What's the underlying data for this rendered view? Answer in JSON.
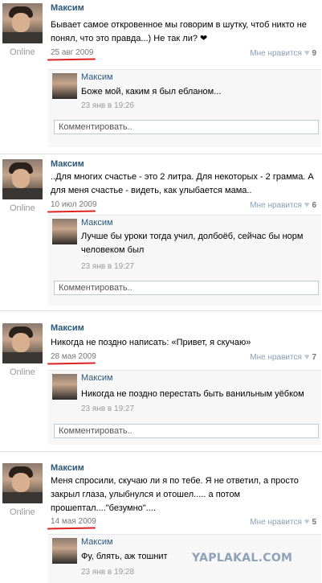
{
  "posts": [
    {
      "author": "Максим",
      "status": "Online",
      "text": "Бывает самое откровенное мы говорим в шутку, чтоб никто не понял, что это правда...) Не так ли? ❤",
      "date": "25 авг 2009",
      "like_label": "Мне нравится",
      "like_count": "9",
      "reply": {
        "author": "Максим",
        "text": "Боже мой, каким я был ебланом...",
        "date": "23 янв в 19:26"
      },
      "comment_placeholder": "Комментировать.."
    },
    {
      "author": "Максим",
      "status": "Online",
      "text": "..Для многих счастье - это 2 литра. Для некоторых - 2 грамма. А для меня счастье - видеть, как улыбается мама..",
      "date": "10 июл 2009",
      "like_label": "Мне нравится",
      "like_count": "6",
      "reply": {
        "author": "Максим",
        "text": "Лучше бы уроки тогда учил, долбоёб, сейчас бы норм человеком был",
        "date": "23 янв в 19:27"
      },
      "comment_placeholder": "Комментировать.."
    },
    {
      "author": "Максим",
      "status": "Online",
      "text": "Никогда не поздно написать: «Привет, я скучаю»",
      "date": "28 мая 2009",
      "like_label": "Мне нравится",
      "like_count": "7",
      "reply": {
        "author": "Максим",
        "text": "Никогда не поздно перестать быть ванильным уёбком",
        "date": "23 янв в 19:27"
      },
      "comment_placeholder": "Комментировать.."
    },
    {
      "author": "Максим",
      "status": "Online",
      "text": "Меня спросили, скучаю ли я по тебе. Я не ответил, а просто закрыл глаза, улыбнулся и отошел..... а потом прошептал....\"безумно\"....",
      "date": "14 мая 2009",
      "like_label": "Мне нравится",
      "like_count": "5",
      "reply": {
        "author": "Максим",
        "text": "Фу, блять, аж тошнит",
        "date": "23 янв в 19:28"
      }
    }
  ],
  "watermark": "YAPLAKAL.COM",
  "colors": {
    "link": "#2b587a",
    "underline": "#dd2222",
    "reply_bg": "#f7f7f7"
  }
}
